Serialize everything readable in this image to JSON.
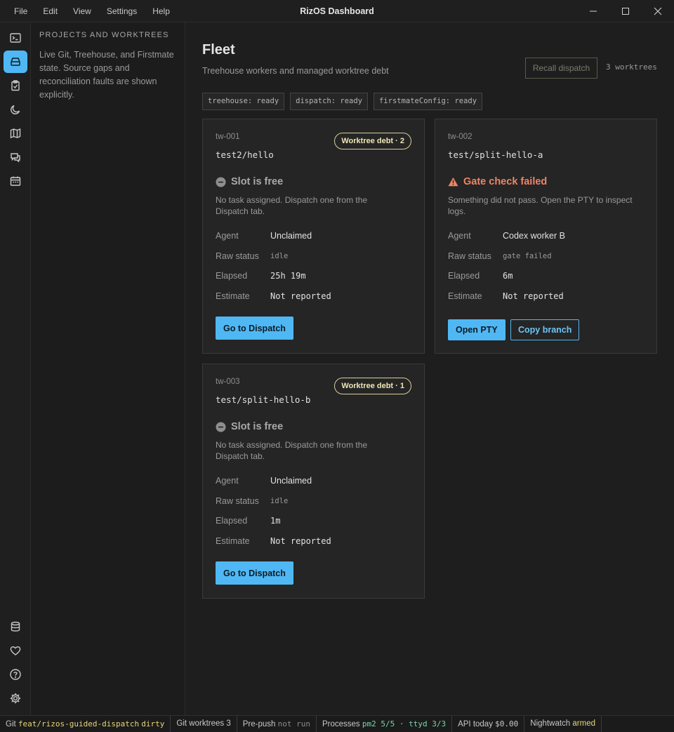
{
  "window": {
    "title": "RizOS Dashboard",
    "menu": [
      "File",
      "Edit",
      "View",
      "Settings",
      "Help"
    ]
  },
  "activity_bar": {
    "top_icons": [
      "terminal-icon",
      "worktrees-icon",
      "clipboard-check-icon",
      "moon-icon",
      "map-icon",
      "chat-icon",
      "calendar-icon"
    ],
    "active": "worktrees-icon",
    "bottom_icons": [
      "database-icon",
      "heart-icon",
      "help-icon",
      "gear-icon"
    ]
  },
  "sidebar": {
    "heading": "PROJECTS AND WORKTREES",
    "description": "Live Git, Treehouse, and Firstmate state. Source gaps and reconciliation faults are shown explicitly."
  },
  "main": {
    "title": "Fleet",
    "subtitle": "Treehouse workers and managed worktree debt",
    "recall_label": "Recall dispatch",
    "worktree_count": "3 worktrees",
    "chips": [
      "treehouse: ready",
      "dispatch: ready",
      "firstmateConfig: ready"
    ],
    "labels": {
      "agent": "Agent",
      "raw_status": "Raw status",
      "elapsed": "Elapsed",
      "estimate": "Estimate"
    },
    "cards": [
      {
        "id": "tw-001",
        "branch": "test2/hello",
        "debt": "Worktree debt · 2",
        "status": "Slot is free",
        "status_desc": "No task assigned. Dispatch one from the Dispatch tab.",
        "agent": "Unclaimed",
        "raw_status": "idle",
        "elapsed": "25h 19m",
        "estimate": "Not reported",
        "primary_action": "Go to Dispatch"
      },
      {
        "id": "tw-002",
        "branch": "test/split-hello-a",
        "status": "Gate check failed",
        "status_desc": "Something did not pass. Open the PTY to inspect logs.",
        "agent": "Codex worker B",
        "raw_status": "gate failed",
        "elapsed": "6m",
        "estimate": "Not reported",
        "primary_action": "Open PTY",
        "secondary_action": "Copy branch"
      },
      {
        "id": "tw-003",
        "branch": "test/split-hello-b",
        "debt": "Worktree debt · 1",
        "status": "Slot is free",
        "status_desc": "No task assigned. Dispatch one from the Dispatch tab.",
        "agent": "Unclaimed",
        "raw_status": "idle",
        "elapsed": "1m",
        "estimate": "Not reported",
        "primary_action": "Go to Dispatch"
      }
    ]
  },
  "statusbar": {
    "git_label": "Git",
    "git_branch": "feat/rizos-guided-dispatch",
    "git_state": "dirty",
    "worktrees": "Git worktrees 3",
    "prepush_label": "Pre-push",
    "prepush_value": "not run",
    "processes_label": "Processes",
    "processes_value": "pm2 5/5 · ttyd 3/3",
    "api_label": "API today",
    "api_value": "$0.00",
    "nightwatch_label": "Nightwatch",
    "nightwatch_value": "armed"
  },
  "colors": {
    "accent": "#4fb8f4",
    "error": "#ee8466",
    "debt_badge": "#d9cf9a"
  }
}
